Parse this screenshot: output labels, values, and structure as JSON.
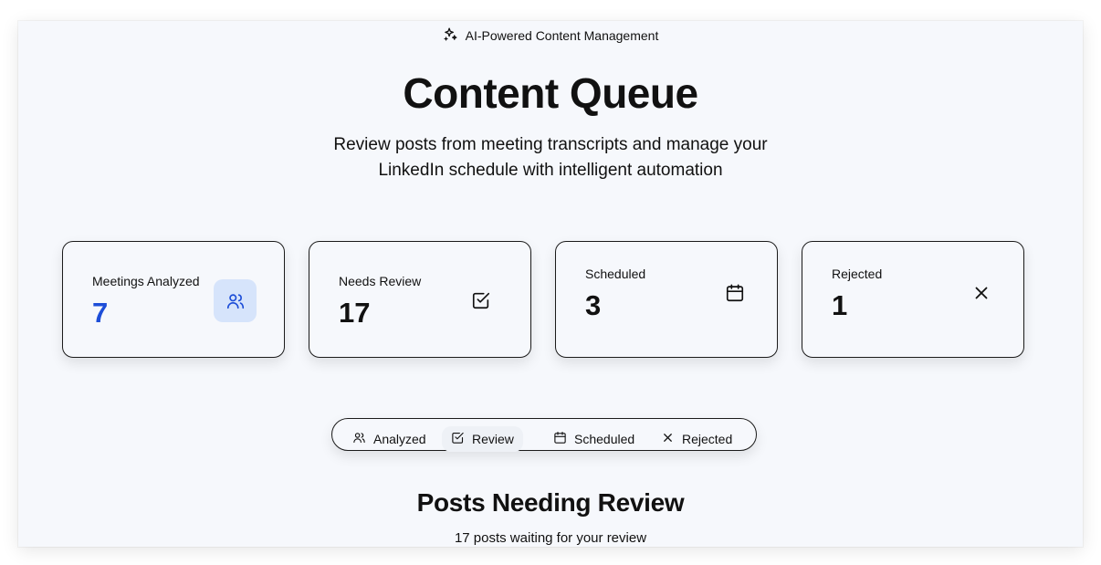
{
  "header": {
    "badge_text": "AI-Powered Content Management",
    "badge_icon": "sparkles-icon",
    "title": "Content Queue",
    "subtitle": "Review posts from meeting transcripts and manage your LinkedIn schedule with intelligent automation"
  },
  "stats": [
    {
      "label": "Meetings Analyzed",
      "value": "7",
      "icon": "users-icon",
      "accent": "#1d4ed8"
    },
    {
      "label": "Needs Review",
      "value": "17",
      "icon": "check-square-icon"
    },
    {
      "label": "Scheduled",
      "value": "3",
      "icon": "calendar-icon"
    },
    {
      "label": "Rejected",
      "value": "1",
      "icon": "x-icon"
    }
  ],
  "tabs": [
    {
      "label": "Analyzed",
      "icon": "users-icon",
      "active": false
    },
    {
      "label": "Review",
      "icon": "check-square-icon",
      "active": true
    },
    {
      "label": "Scheduled",
      "icon": "calendar-icon",
      "active": false
    },
    {
      "label": "Rejected",
      "icon": "x-icon",
      "active": false
    }
  ],
  "section": {
    "title": "Posts Needing Review",
    "subtitle": "17 posts waiting for your review"
  },
  "colors": {
    "background": "#f6f8fc",
    "accent": "#1d4ed8",
    "accent_bg": "#d6e4fb"
  }
}
